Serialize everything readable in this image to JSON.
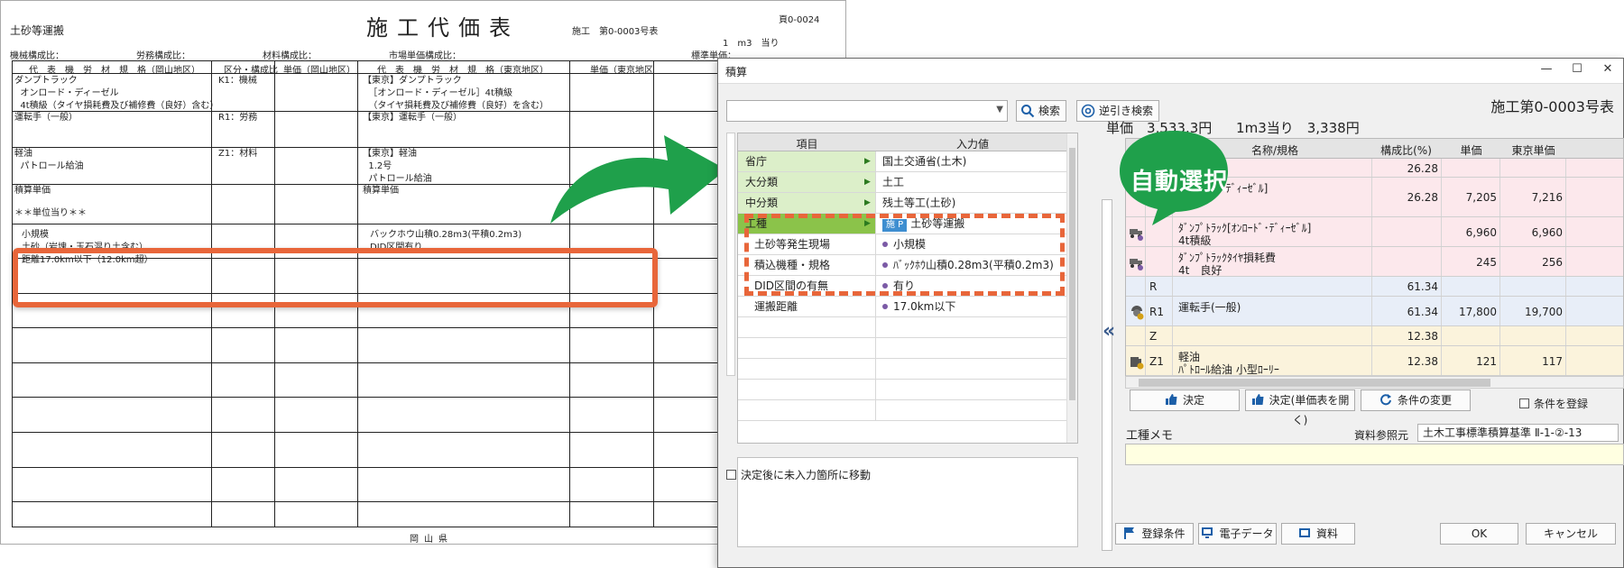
{
  "document": {
    "top_left": "土砂等運搬",
    "title": "施工代価表",
    "form_code": "施工　第0-0003号表",
    "page_no": "頁0-0024",
    "unit": "1　m3　当り",
    "ratios": [
      "機械構成比：",
      "労務構成比：",
      "材料構成比：",
      "市場単価構成比：",
      "標準単価："
    ],
    "headers": [
      "代　表　機　労　材　規　格（岡山地区）",
      "区分・構成比",
      "単価（岡山地区）",
      "代　表　機　労　材　規　格（東京地区）",
      "単価（東京地区"
    ],
    "rows": [
      {
        "left": "ダンプトラック\n  オンロード・ディーゼル\n  4t積級（タイヤ損耗費及び補修費（良好）含む）",
        "kubun": "K1：機械",
        "right": "【東京】ダンプトラック\n  ［オンロード・ディーゼル］4t積級\n  （タイヤ損耗費及び補修費（良好）を含む）"
      },
      {
        "left": "運転手（一般）",
        "kubun": "R1：労務",
        "right": "【東京】運転手（一般）"
      },
      {
        "left": "軽油\n  パトロール給油",
        "kubun": "Z1：材料",
        "right": "【東京】軽油\n  1.2号\n  パトロール給油"
      },
      {
        "left": "積算単価",
        "kubun": "",
        "right": "積算単価"
      },
      {
        "left": "＊＊単位当り＊＊",
        "kubun": "",
        "right": ""
      },
      {
        "left": "小規模\n土砂（岩塊・玉石混り土含む）\n距離17.0km以下（12.0km超）",
        "kubun": "",
        "right": "バックホウ山積0.28m3(平積0.2m3)\nDID区間有り"
      }
    ],
    "footer": "岡山県"
  },
  "callout_label": "自動選択",
  "dialog": {
    "title": "積算",
    "window_buttons": [
      "—",
      "☐",
      "✕"
    ],
    "search_button": "検索",
    "reverse_search_button": "逆引き検索",
    "form_no": "施工第0-0003号表",
    "grid_headers": [
      "項目",
      "入力値"
    ],
    "grid_rows": [
      {
        "key": "省庁",
        "value": "国土交通省(土木)",
        "level": "category"
      },
      {
        "key": "大分類",
        "value": "土工",
        "level": "category"
      },
      {
        "key": "中分類",
        "value": "残土等工(土砂)",
        "level": "category"
      },
      {
        "key": "工種",
        "value": "土砂等運搬",
        "tag": "施 P",
        "level": "selected"
      },
      {
        "key": "土砂等発生現場",
        "value": "小規模",
        "level": "param"
      },
      {
        "key": "積込機種・規格",
        "value": "ﾊﾞｯｸﾎｳ山積0.28m3(平積0.2m3)",
        "level": "param"
      },
      {
        "key": "DID区間の有無",
        "value": "有り",
        "level": "param"
      },
      {
        "key": "運搬距離",
        "value": "17.0km以下",
        "level": "param"
      },
      {
        "key": "",
        "value": "",
        "level": "empty"
      },
      {
        "key": "",
        "value": "",
        "level": "empty"
      },
      {
        "key": "",
        "value": "",
        "level": "empty"
      },
      {
        "key": "",
        "value": "",
        "level": "empty"
      },
      {
        "key": "",
        "value": "",
        "level": "empty"
      }
    ],
    "move_checkbox": "決定後に未入力箇所に移動",
    "amount": {
      "price": "単価　3,533.3円",
      "per_unit": "1m3当り　3,338円"
    },
    "table_headers": [
      "名称/規格",
      "構成比(%)",
      "単価",
      "東京単価"
    ],
    "table_rows": [
      {
        "code": "",
        "name": "",
        "sub": "",
        "ratio": "26.28",
        "price": "",
        "tokyo": "",
        "color": "#fce8ec",
        "icon": ""
      },
      {
        "code": "",
        "name": "ﾝ[ｵﾝﾛｰﾄﾞ･ﾃﾞｨｰｾﾞﾙ]",
        "sub": "",
        "ratio": "26.28",
        "price": "7,205",
        "tokyo": "7,216",
        "color": "#fce8ec",
        "icon": ""
      },
      {
        "code": "",
        "name": "ﾀﾞﾝﾌﾟﾄﾗｯｸ[ｵﾝﾛｰﾄﾞ･ﾃﾞｨｰｾﾞﾙ]",
        "sub": "4t積級",
        "ratio": "",
        "price": "6,960",
        "tokyo": "6,960",
        "color": "#fce8ec",
        "icon": "truck-icon"
      },
      {
        "code": "",
        "name": "ﾀﾞﾝﾌﾟﾄﾗｯｸﾀｲﾔ損耗費",
        "sub": "4t　良好",
        "ratio": "",
        "price": "245",
        "tokyo": "256",
        "color": "#fce8ec",
        "icon": "truck-icon"
      },
      {
        "code": "R",
        "name": "",
        "sub": "",
        "ratio": "61.34",
        "price": "",
        "tokyo": "",
        "color": "#e8eef8",
        "icon": ""
      },
      {
        "code": "R1",
        "name": "運転手(一般)",
        "sub": "",
        "ratio": "61.34",
        "price": "17,800",
        "tokyo": "19,700",
        "color": "#e8eef8",
        "icon": "worker-icon"
      },
      {
        "code": "Z",
        "name": "",
        "sub": "",
        "ratio": "12.38",
        "price": "",
        "tokyo": "",
        "color": "#fbf3dc",
        "icon": ""
      },
      {
        "code": "Z1",
        "name": "軽油",
        "sub": "ﾊﾟﾄﾛｰﾙ給油 小型ﾛｰﾘｰ",
        "ratio": "12.38",
        "price": "121",
        "tokyo": "117",
        "color": "#fbf3dc",
        "icon": "fuel-icon"
      }
    ],
    "decide_button": "決定",
    "decide_open_button": "決定(単価表を開く)",
    "change_button": "条件の変更",
    "register_checkbox": "条件を登録",
    "memo_label": "工種メモ",
    "ref_label": "資料参照元",
    "ref_value": "土木工事標準積算基準 Ⅱ-1-②-13",
    "footer_buttons": {
      "register": "登録条件",
      "edata": "電子データ",
      "material": "資料",
      "ok": "OK",
      "cancel": "キャンセル"
    }
  },
  "colors": {
    "accent_orange": "#e8663a",
    "arrow_green": "#1fa04b",
    "selected_row": "#8bc34a",
    "category_row": "#dcefc9"
  }
}
